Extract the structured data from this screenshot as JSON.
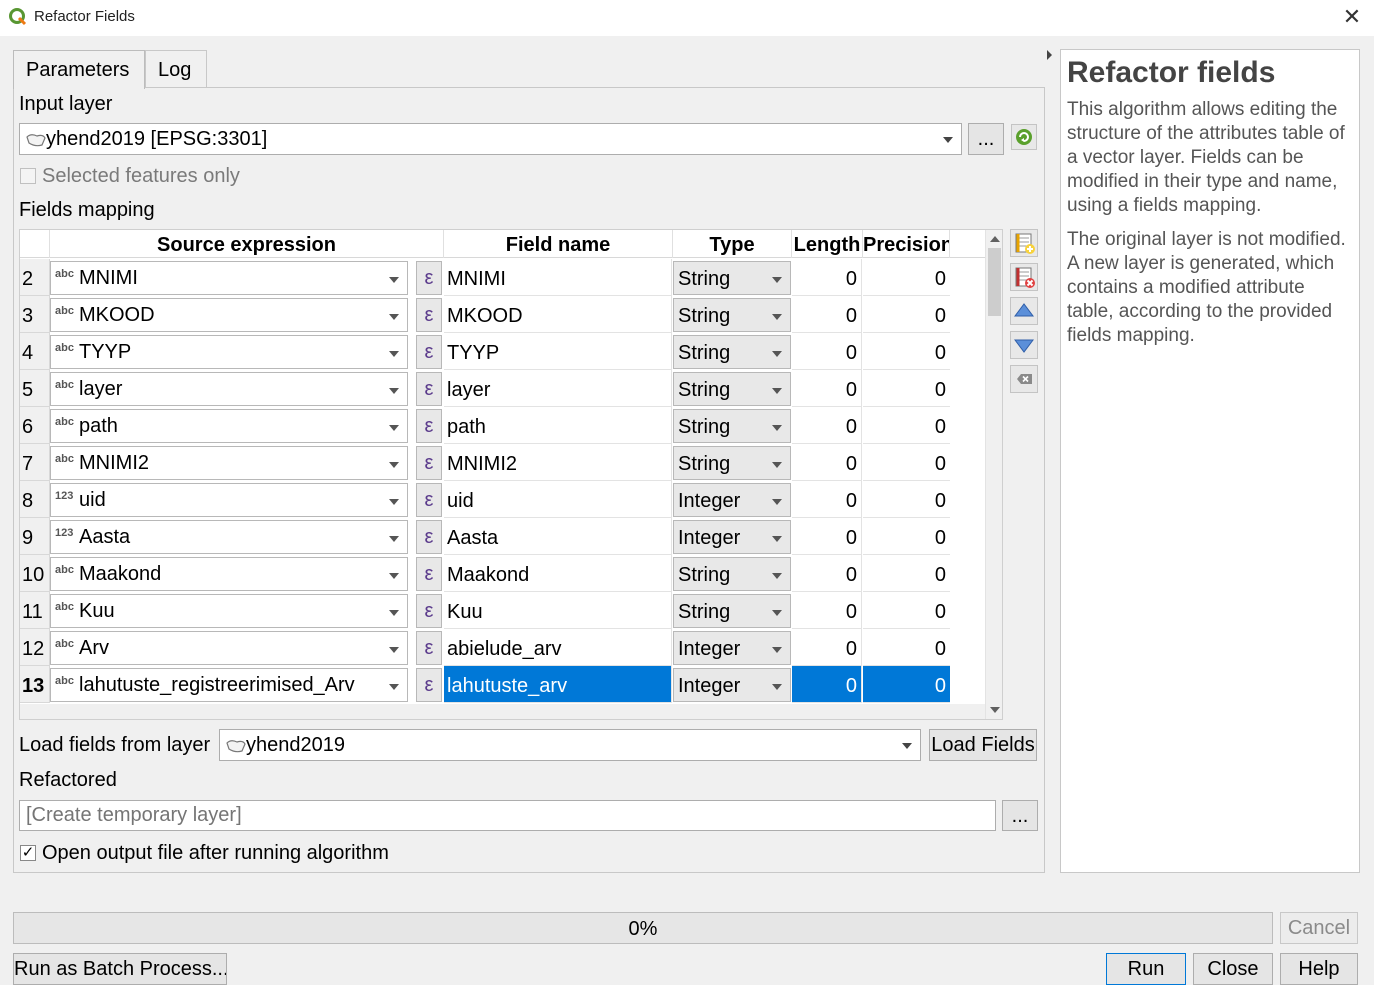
{
  "window": {
    "title": "Refactor Fields",
    "close_glyph": "✕"
  },
  "tabs": [
    {
      "label": "Parameters",
      "active": true
    },
    {
      "label": "Log",
      "active": false
    }
  ],
  "input_layer": {
    "label": "Input layer",
    "value": "yhend2019 [EPSG:3301]",
    "browse_label": "...",
    "selected_only_label": "Selected features only",
    "selected_only_checked": false
  },
  "fields_mapping": {
    "label": "Fields mapping",
    "headers": {
      "source": "Source expression",
      "name": "Field name",
      "type": "Type",
      "length": "Length",
      "precision": "Precision"
    },
    "expression_glyph": "ε",
    "rows": [
      {
        "num": "2",
        "src_type": "abc",
        "src": "MNIMI",
        "name": "MNIMI",
        "type": "String",
        "length": "0",
        "precision": "0"
      },
      {
        "num": "3",
        "src_type": "abc",
        "src": "MKOOD",
        "name": "MKOOD",
        "type": "String",
        "length": "0",
        "precision": "0"
      },
      {
        "num": "4",
        "src_type": "abc",
        "src": "TYYP",
        "name": "TYYP",
        "type": "String",
        "length": "0",
        "precision": "0"
      },
      {
        "num": "5",
        "src_type": "abc",
        "src": "layer",
        "name": "layer",
        "type": "String",
        "length": "0",
        "precision": "0"
      },
      {
        "num": "6",
        "src_type": "abc",
        "src": "path",
        "name": "path",
        "type": "String",
        "length": "0",
        "precision": "0"
      },
      {
        "num": "7",
        "src_type": "abc",
        "src": "MNIMI2",
        "name": "MNIMI2",
        "type": "String",
        "length": "0",
        "precision": "0"
      },
      {
        "num": "8",
        "src_type": "123",
        "src": "uid",
        "name": "uid",
        "type": "Integer",
        "length": "0",
        "precision": "0"
      },
      {
        "num": "9",
        "src_type": "123",
        "src": "Aasta",
        "name": "Aasta",
        "type": "Integer",
        "length": "0",
        "precision": "0"
      },
      {
        "num": "10",
        "src_type": "abc",
        "src": "Maakond",
        "name": "Maakond",
        "type": "String",
        "length": "0",
        "precision": "0"
      },
      {
        "num": "11",
        "src_type": "abc",
        "src": "Kuu",
        "name": "Kuu",
        "type": "String",
        "length": "0",
        "precision": "0"
      },
      {
        "num": "12",
        "src_type": "abc",
        "src": "Arv",
        "name": "abielude_arv",
        "type": "Integer",
        "length": "0",
        "precision": "0"
      },
      {
        "num": "13",
        "src_type": "abc",
        "src": "lahutuste_registreerimised_Arv",
        "name": "lahutuste_arv",
        "type": "Integer",
        "length": "0",
        "precision": "0",
        "selected": true
      }
    ]
  },
  "load_fields": {
    "label": "Load fields from layer",
    "layer": "yhend2019",
    "button": "Load Fields"
  },
  "refactored": {
    "label": "Refactored",
    "placeholder": "[Create temporary layer]",
    "browse_label": "...",
    "open_output_label": "Open output file after running algorithm",
    "open_output_checked": true
  },
  "progress": {
    "text": "0%",
    "value": 0
  },
  "buttons": {
    "cancel": "Cancel",
    "batch": "Run as Batch Process...",
    "run": "Run",
    "close": "Close",
    "help": "Help"
  },
  "help_panel": {
    "title": "Refactor fields",
    "p1": "This algorithm allows editing the structure of the attributes table of a vector layer. Fields can be modified in their type and name, using a fields mapping.",
    "p2": "The original layer is not modified. A new layer is generated, which contains a modified attribute table, according to the provided fields mapping."
  },
  "colors": {
    "accent": "#0078d7",
    "qgis_green": "#589632",
    "expression": "#5b3b8c"
  }
}
